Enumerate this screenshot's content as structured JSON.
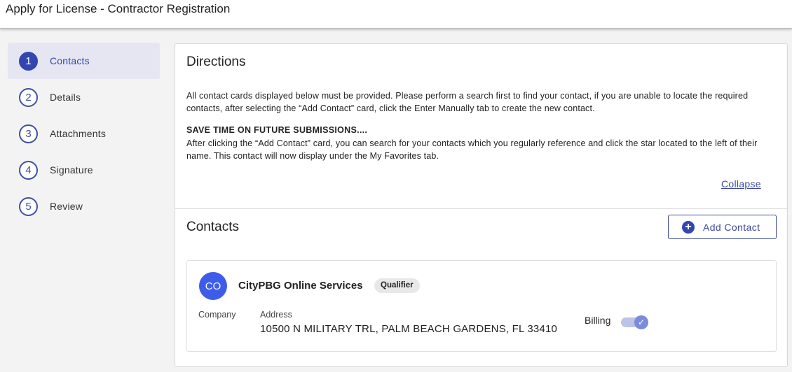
{
  "header": {
    "title": "Apply for License - Contractor Registration"
  },
  "steps": [
    {
      "num": "1",
      "label": "Contacts"
    },
    {
      "num": "2",
      "label": "Details"
    },
    {
      "num": "3",
      "label": "Attachments"
    },
    {
      "num": "4",
      "label": "Signature"
    },
    {
      "num": "5",
      "label": "Review"
    }
  ],
  "directions": {
    "title": "Directions",
    "text1": "All contact cards displayed below must be provided. Please perform a search first to find your contact, if you are unable to locate the required contacts, after selecting the “Add Contact” card, click the Enter Manually tab to create the new contact.",
    "heading": "SAVE TIME ON FUTURE SUBMISSIONS....",
    "text2": "After clicking the “Add Contact” card, you can search for your contacts which you regularly reference and click the star located to the left of their name. This contact will now display under the My Favorites tab.",
    "collapse_label": "Collapse"
  },
  "contacts": {
    "title": "Contacts",
    "add_button_label": "Add Contact",
    "add_icon": "plus-circle-icon",
    "card": {
      "initials": "CO",
      "name": "CityPBG Online Services",
      "badge": "Qualifier",
      "type": "Company",
      "address_label": "Address",
      "address": "10500 N MILITARY TRL, PALM BEACH GARDENS, FL 33410",
      "billing_label": "Billing",
      "billing_on": true
    }
  },
  "colors": {
    "accent": "#3346b0",
    "avatar": "#3d5ce8",
    "active_step_bg": "#e6e6f3"
  }
}
